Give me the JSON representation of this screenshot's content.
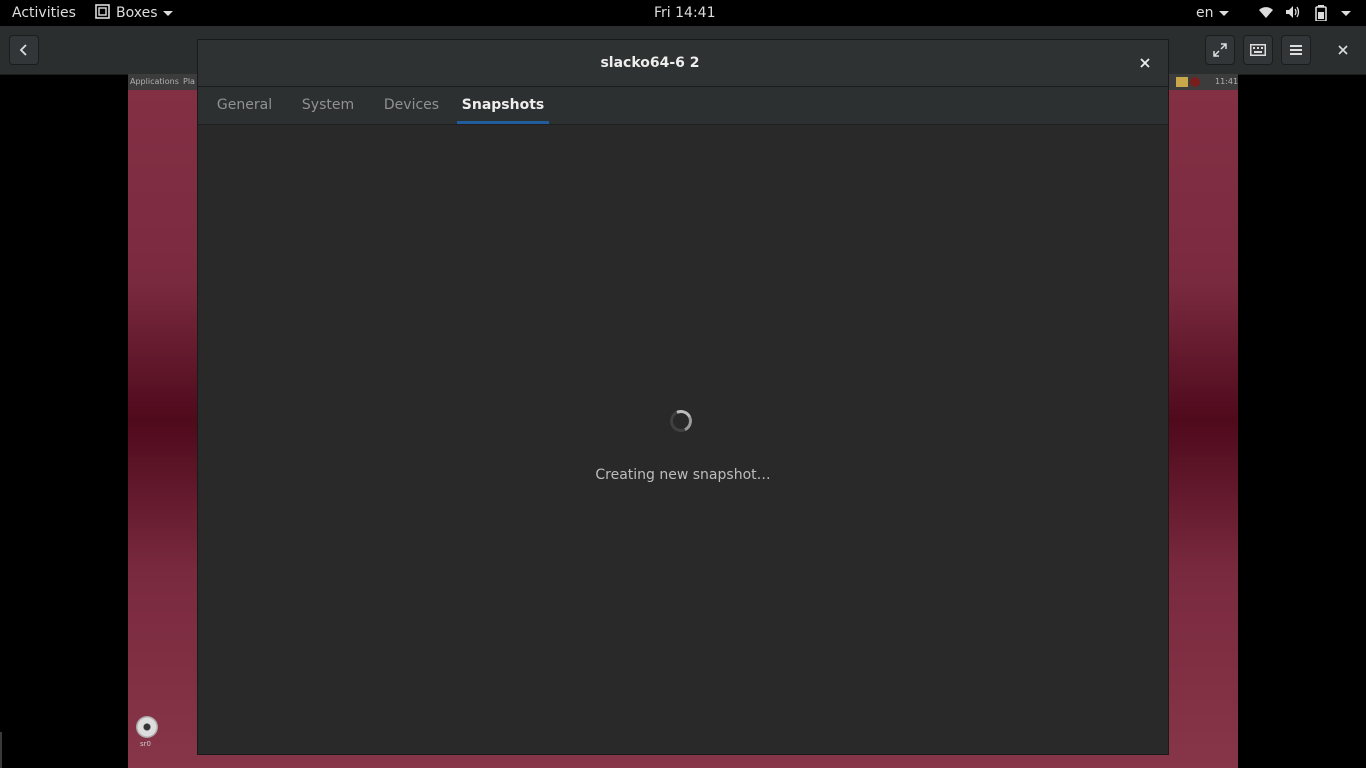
{
  "topbar": {
    "activities": "Activities",
    "app_menu": "Boxes",
    "clock": "Fri 14:41",
    "keyboard_layout": "en"
  },
  "guest": {
    "panel_menu": "Applications",
    "panel_menu2": "Pla",
    "panel_clock": "11:41",
    "disk_label": "sr0"
  },
  "dialog": {
    "title": "slacko64-6 2",
    "tabs": [
      {
        "label": "General"
      },
      {
        "label": "System"
      },
      {
        "label": "Devices"
      },
      {
        "label": "Snapshots",
        "active": true
      }
    ],
    "status": "Creating new snapshot…"
  },
  "colors": {
    "accent": "#215d9c",
    "dialog_bg": "#292929",
    "guest_bg": "#7a2a3f"
  }
}
